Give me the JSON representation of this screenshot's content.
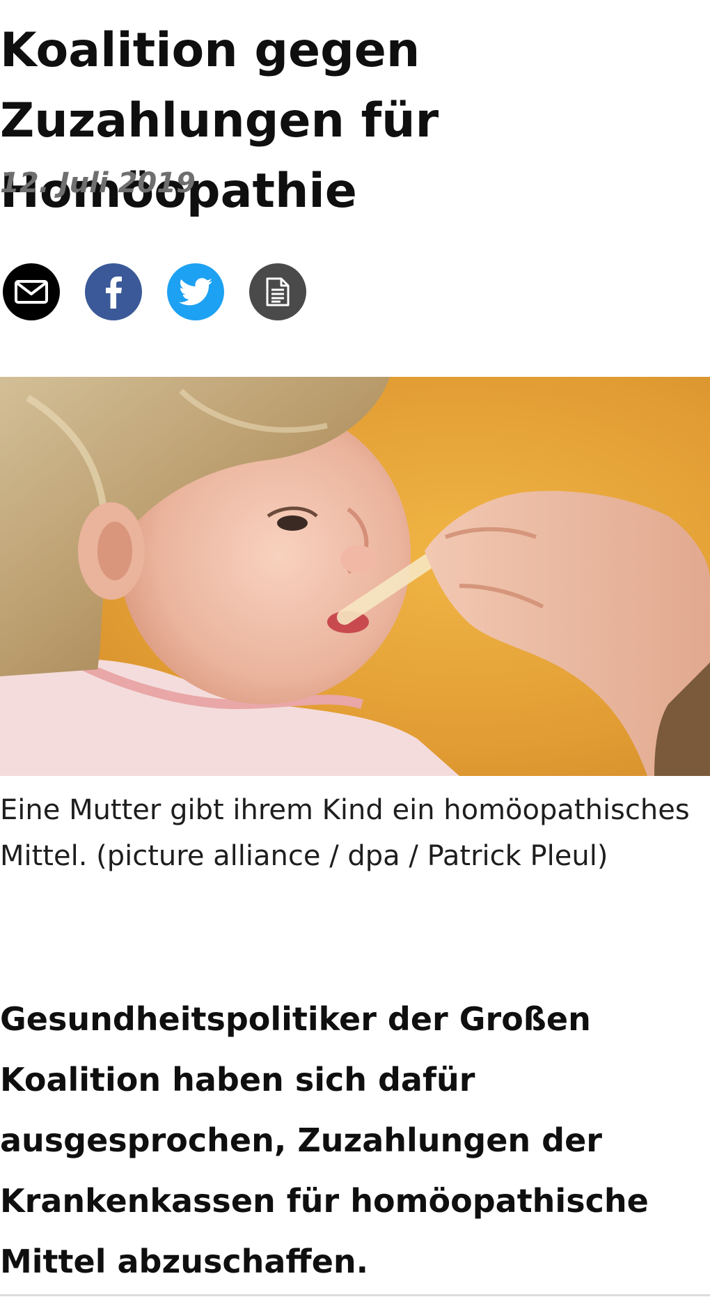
{
  "article": {
    "title": "Koalition gegen Zuzahlungen für Homöopathie",
    "date": "12. Juli 2019",
    "share": [
      {
        "icon": "mail-icon",
        "label": "E-Mail"
      },
      {
        "icon": "facebook-icon",
        "label": "Facebook"
      },
      {
        "icon": "twitter-icon",
        "label": "Twitter"
      },
      {
        "icon": "document-icon",
        "label": "Drucken"
      }
    ],
    "image_caption": "Eine Mutter gibt ihrem Kind ein homöopathisches Mittel. (picture alliance / dpa / Patrick Pleul)",
    "lead": "Gesundheitspolitiker der Großen Koalition haben sich dafür ausgesprochen, Zuzahlungen der Krankenkassen für homöopathische Mittel abzuschaffen."
  },
  "colors": {
    "mail": "#000000",
    "facebook": "#3b5998",
    "twitter": "#1da1f2",
    "document": "#4a4a4a",
    "date": "#6f6f6f"
  }
}
